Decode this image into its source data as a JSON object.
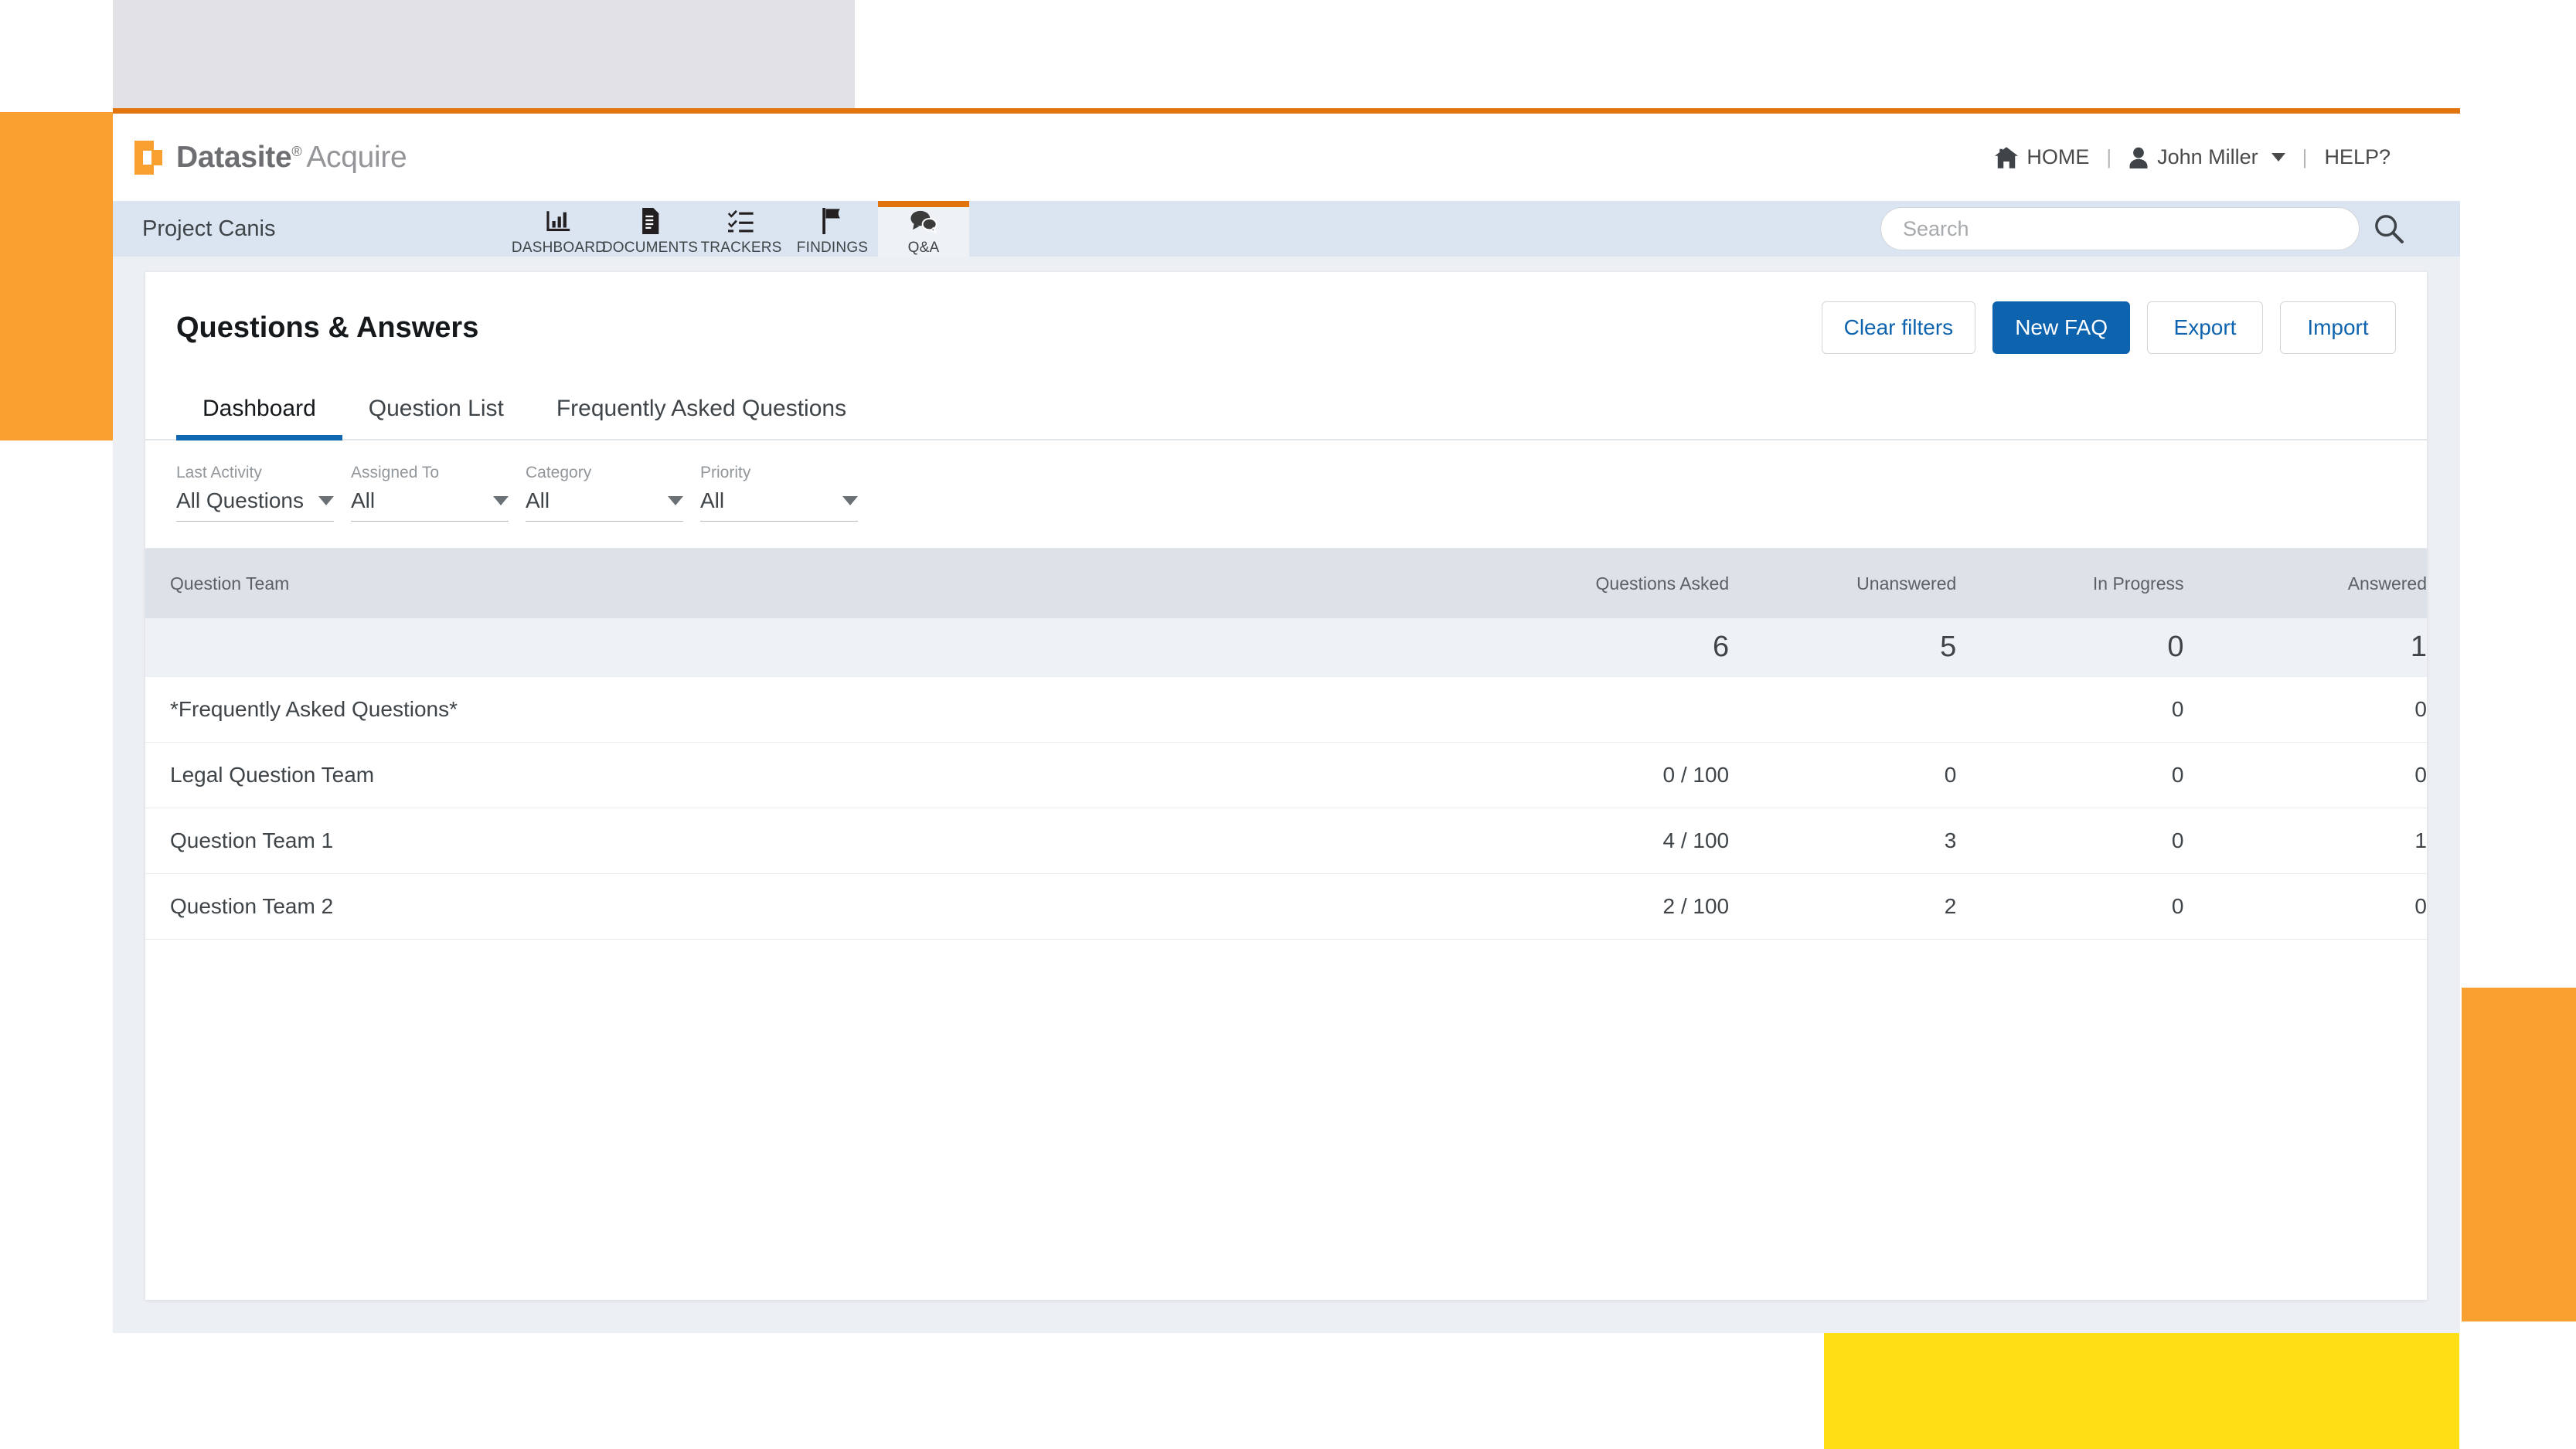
{
  "brand": {
    "name_bold": "Datasite",
    "registered": "®",
    "product": "Acquire",
    "mark_icon": "datasite-logo-mark"
  },
  "masthead": {
    "home_label": "HOME",
    "home_icon": "home-icon",
    "separator": "|",
    "user_name": "John Miller",
    "user_icon": "user-icon",
    "user_caret_icon": "chevron-down-icon",
    "help_label": "HELP?"
  },
  "projectbar": {
    "project_name": "Project Canis",
    "nav": [
      {
        "label": "DASHBOARD",
        "icon": "bar-chart-icon",
        "active": false
      },
      {
        "label": "DOCUMENTS",
        "icon": "document-icon",
        "active": false
      },
      {
        "label": "TRACKERS",
        "icon": "checklist-icon",
        "active": false
      },
      {
        "label": "FINDINGS",
        "icon": "flag-icon",
        "active": false
      },
      {
        "label": "Q&A",
        "icon": "chat-bubbles-icon",
        "active": true
      }
    ],
    "search": {
      "placeholder": "Search",
      "value": "",
      "icon": "search-icon"
    }
  },
  "page": {
    "title": "Questions & Answers",
    "actions": [
      {
        "label": "Clear filters",
        "style": "secondary"
      },
      {
        "label": "New FAQ",
        "style": "primary"
      },
      {
        "label": "Export",
        "style": "secondary"
      },
      {
        "label": "Import",
        "style": "secondary"
      }
    ],
    "tabs": [
      {
        "label": "Dashboard",
        "active": true
      },
      {
        "label": "Question List",
        "active": false
      },
      {
        "label": "Frequently Asked Questions",
        "active": false
      }
    ],
    "filters": [
      {
        "label": "Last Activity",
        "value": "All Questions",
        "caret_icon": "chevron-down-icon"
      },
      {
        "label": "Assigned To",
        "value": "All",
        "caret_icon": "chevron-down-icon"
      },
      {
        "label": "Category",
        "value": "All",
        "caret_icon": "chevron-down-icon"
      },
      {
        "label": "Priority",
        "value": "All",
        "caret_icon": "chevron-down-icon"
      }
    ]
  },
  "table": {
    "headers": {
      "team": "Question Team",
      "asked": "Questions Asked",
      "unanswered": "Unanswered",
      "in_progress": "In Progress",
      "answered": "Answered"
    },
    "totals": {
      "team": "",
      "asked": "6",
      "unanswered": "5",
      "in_progress": "0",
      "answered": "1"
    },
    "totals_colors": {
      "asked": "#2aa3e0",
      "unanswered": "#db3b2b",
      "in_progress": "#f5a623",
      "answered": "#3aab55"
    },
    "rows": [
      {
        "team": "*Frequently Asked Questions*",
        "asked": "",
        "unanswered": "",
        "in_progress": "0",
        "answered": "0"
      },
      {
        "team": "Legal Question Team",
        "asked": "0 / 100",
        "unanswered": "0",
        "in_progress": "0",
        "answered": "0"
      },
      {
        "team": "Question Team 1",
        "asked": "4 / 100",
        "unanswered": "3",
        "in_progress": "0",
        "answered": "1"
      },
      {
        "team": "Question Team 2",
        "asked": "2 / 100",
        "unanswered": "2",
        "in_progress": "0",
        "answered": "0"
      }
    ]
  },
  "decor": {
    "orange": "#faa031",
    "yellow": "#fedf16",
    "gray": "#e2e2e6",
    "accent_orange": "#e2740d",
    "accent_blue": "#0d63ad"
  }
}
